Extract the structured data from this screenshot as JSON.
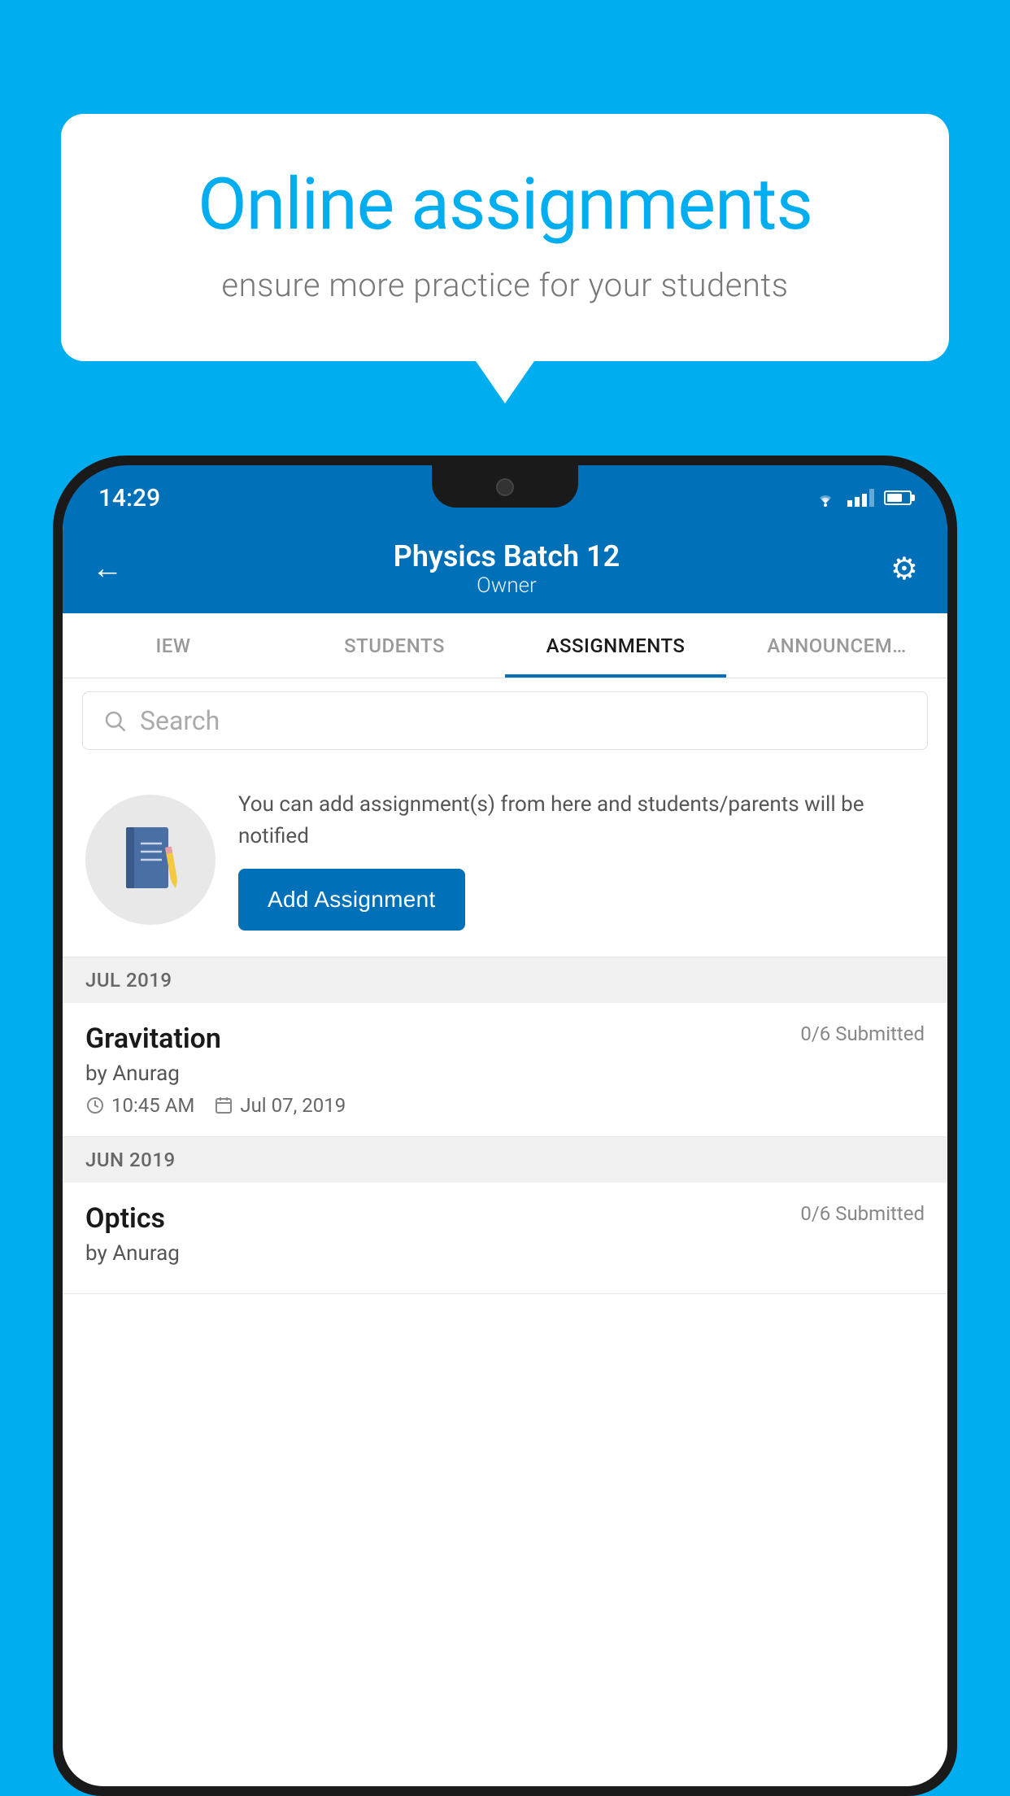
{
  "background_color": "#00AEEF",
  "speech_bubble": {
    "title": "Online assignments",
    "subtitle": "ensure more practice for your students"
  },
  "status_bar": {
    "time": "14:29"
  },
  "header": {
    "title": "Physics Batch 12",
    "subtitle": "Owner",
    "back_label": "←",
    "settings_label": "⚙"
  },
  "tabs": [
    {
      "label": "IEW",
      "active": false
    },
    {
      "label": "STUDENTS",
      "active": false
    },
    {
      "label": "ASSIGNMENTS",
      "active": true
    },
    {
      "label": "ANNOUNCEM…",
      "active": false
    }
  ],
  "search": {
    "placeholder": "Search"
  },
  "promo": {
    "text": "You can add assignment(s) from here and students/parents will be notified",
    "button_label": "Add Assignment"
  },
  "sections": [
    {
      "month": "JUL 2019",
      "assignments": [
        {
          "name": "Gravitation",
          "submitted": "0/6 Submitted",
          "author": "by Anurag",
          "time": "10:45 AM",
          "date": "Jul 07, 2019"
        }
      ]
    },
    {
      "month": "JUN 2019",
      "assignments": [
        {
          "name": "Optics",
          "submitted": "0/6 Submitted",
          "author": "by Anurag",
          "time": "",
          "date": ""
        }
      ]
    }
  ]
}
